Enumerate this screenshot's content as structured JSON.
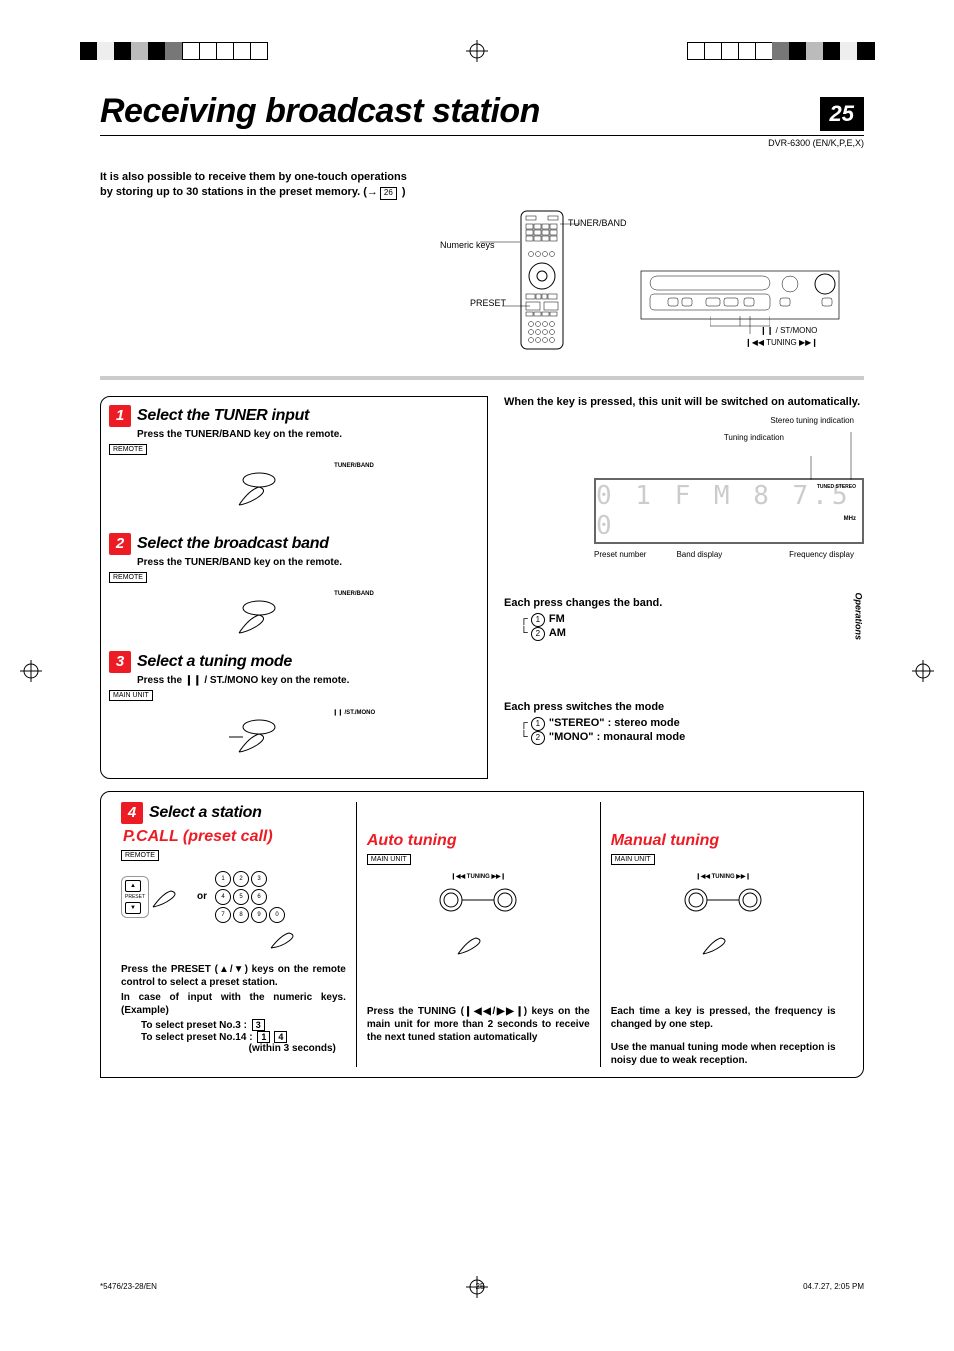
{
  "page": {
    "title": "Receiving broadcast station",
    "number": "25",
    "model_ref": "DVR-6300 (EN/K,P,E,X)",
    "side_tab": "Operations"
  },
  "intro": {
    "line1": "It is also possible to receive them by one-touch operations",
    "line2_pre": "by storing up to 30 stations in the preset memory. (",
    "arrow": "→",
    "pgref": "26",
    "line2_post": " )"
  },
  "top_labels": {
    "numeric": "Numeric keys",
    "preset": "PRESET",
    "tuner_band": "TUNER/BAND",
    "st_mono": "❙❙ / ST/MONO",
    "tuning": "❙◀◀ TUNING ▶▶❙"
  },
  "step1": {
    "num": "1",
    "title": "Select the TUNER input",
    "sub": "Press the TUNER/BAND key on the remote.",
    "tag": "REMOTE",
    "btn_label": "TUNER/BAND"
  },
  "step2": {
    "num": "2",
    "title": "Select the broadcast band",
    "sub": "Press the TUNER/BAND key on the remote.",
    "tag": "REMOTE",
    "btn_label": "TUNER/BAND"
  },
  "step3": {
    "num": "3",
    "title": "Select a tuning mode",
    "sub": "Press the ❙❙ / ST./MONO key on the remote.",
    "tag": "MAIN UNIT",
    "btn_label": "❙❙ /ST./MONO"
  },
  "right1": {
    "head": "When the key is pressed, this unit will be switched on automatically.",
    "above_r1": "Stereo tuning indication",
    "above_r2": "Tuning indication",
    "disp_tuned": "TUNED  STEREO",
    "disp_text": "0 1  F M   8 7.5 0",
    "disp_mhz": "MHz",
    "below1": "Preset number",
    "below2": "Band display",
    "below3": "Frequency display"
  },
  "right2": {
    "head": "Each press changes the band.",
    "item1": "FM",
    "item2": "AM"
  },
  "right3": {
    "head": "Each press switches the mode",
    "item1": "\"STEREO\" : stereo mode",
    "item2": "\"MONO\" : monaural mode"
  },
  "step4": {
    "num": "4",
    "title": "Select a station",
    "pcall": {
      "title": "P.CALL (preset call)",
      "tag": "REMOTE",
      "or": "or",
      "body1": "Press the PRESET (▲/▼) keys on the remote control to select a preset station.",
      "body2": "In case of input with the numeric keys. (Example)",
      "ex1_label": "To select preset No.3 :",
      "ex1_key": "3",
      "ex2_label": "To select preset No.14 :",
      "ex2_key1": "1",
      "ex2_key2": "4",
      "ex2_note": "(within 3 seconds)"
    },
    "auto": {
      "title": "Auto tuning",
      "tag": "MAIN UNIT",
      "btn_label": "❙◀◀  TUNING  ▶▶❙",
      "body": "Press the TUNING (❙◀◀/▶▶❙) keys on the main unit for more than 2 seconds to receive the next tuned station automatically"
    },
    "manual": {
      "title": "Manual tuning",
      "tag": "MAIN UNIT",
      "btn_label": "❙◀◀  TUNING  ▶▶❙",
      "body1": "Each time a key is pressed, the frequency is changed by one step.",
      "body2": "Use the manual tuning mode when reception is noisy due to weak reception."
    }
  },
  "footer": {
    "left": "*5476/23-28/EN",
    "center": "25",
    "right": "04.7.27, 2:05 PM"
  },
  "keys": {
    "k1": "1",
    "k2": "2",
    "k3": "3",
    "k4": "4",
    "k5": "5",
    "k6": "6",
    "k7": "7",
    "k8": "8",
    "k9": "9",
    "k0": "0"
  }
}
